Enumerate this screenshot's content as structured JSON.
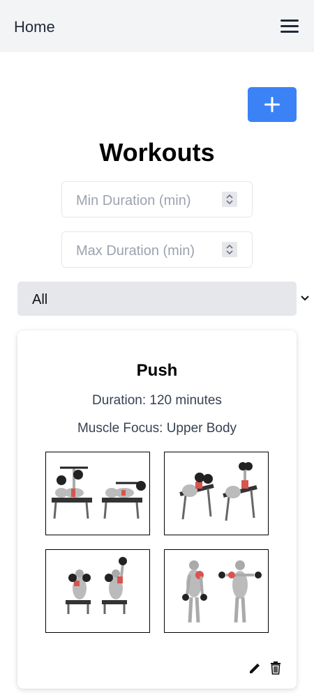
{
  "header": {
    "home_label": "Home",
    "menu_icon": "hamburger-menu-icon"
  },
  "toolbar": {
    "add_icon": "plus-icon",
    "accent_color": "#3b82f6"
  },
  "page": {
    "title": "Workouts"
  },
  "filters": {
    "min_duration": {
      "placeholder": "Min Duration (min)",
      "value": ""
    },
    "max_duration": {
      "placeholder": "Max Duration (min)",
      "value": ""
    },
    "muscle_select": {
      "selected": "All"
    }
  },
  "workouts": [
    {
      "name": "Push",
      "duration_text": "Duration: 120 minutes",
      "focus_text": "Muscle Focus: Upper Body",
      "images": [
        "bench-press-exercise-illustration",
        "dumbbell-fly-exercise-illustration",
        "shoulder-press-exercise-illustration",
        "lateral-raise-exercise-illustration"
      ],
      "actions": [
        "edit-pencil-icon",
        "delete-trash-icon"
      ]
    }
  ]
}
